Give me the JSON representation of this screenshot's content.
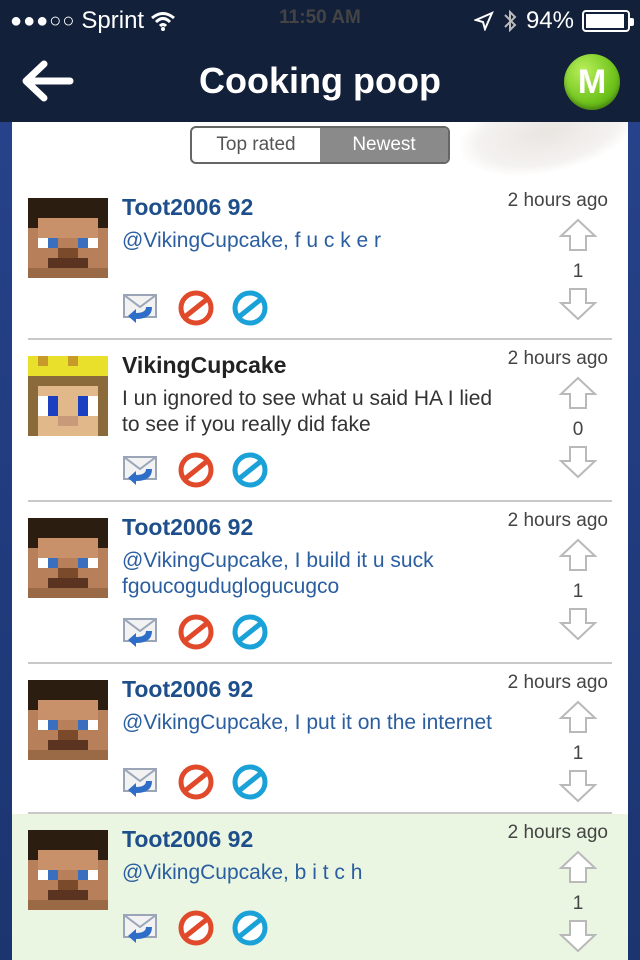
{
  "status": {
    "carrier": "Sprint",
    "time": "11:50 AM",
    "battery": "94%",
    "battery_level": 0.94
  },
  "nav": {
    "title": "Cooking poop",
    "logo_letter": "M"
  },
  "tabs": [
    {
      "label": "Top rated",
      "active": false
    },
    {
      "label": "Newest",
      "active": true
    }
  ],
  "comments": [
    {
      "user": "Toot2006 92",
      "text": "@VikingCupcake, f u c k e r",
      "time": "2 hours ago",
      "votes": "1"
    },
    {
      "user": "VikingCupcake",
      "text": "I un ignored to see what u said HA I lied to see if you really did fake",
      "time": "2 hours ago",
      "votes": "0"
    },
    {
      "user": "Toot2006 92",
      "text": "@VikingCupcake, I build it u suck fgoucoguduglogucugco",
      "time": "2 hours ago",
      "votes": "1"
    },
    {
      "user": "Toot2006 92",
      "text": "@VikingCupcake, I put it on the internet",
      "time": "2 hours ago",
      "votes": "1"
    },
    {
      "user": "Toot2006 92",
      "text": "@VikingCupcake, b i t c h",
      "time": "2 hours ago",
      "votes": "1"
    }
  ],
  "colors": {
    "bar_bg": "#13203a",
    "username_blue": "#1e4f8a",
    "highlight_row": "#eaf6e2",
    "logo_green": "#6fc21c"
  },
  "icons": [
    "back-arrow-icon",
    "wifi-icon",
    "location-icon",
    "bluetooth-icon",
    "reply-icon",
    "block-icon",
    "ignore-icon",
    "upvote-icon",
    "downvote-icon"
  ]
}
